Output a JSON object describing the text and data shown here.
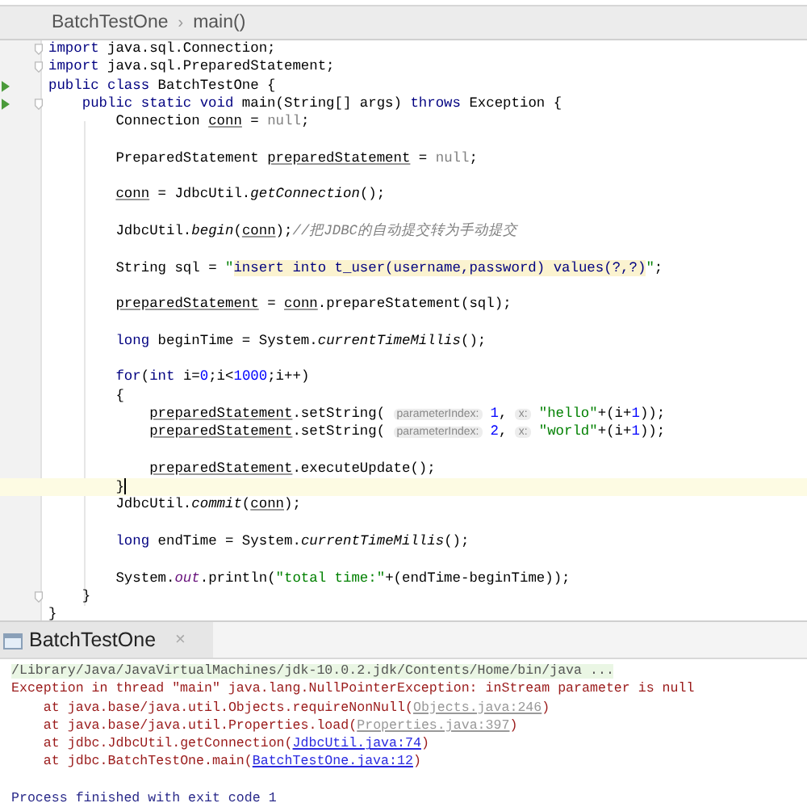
{
  "breadcrumbs": [
    {
      "text": "BatchTestOne"
    },
    {
      "text": "main()"
    }
  ],
  "breadcrumb_separator": "›",
  "editor": {
    "lines": [
      {
        "current": false,
        "run": false,
        "fold": true,
        "tokens": [
          {
            "kind": "kw",
            "text": "import"
          },
          {
            "kind": "plain",
            "text": " java.sql.Connection;"
          }
        ]
      },
      {
        "current": false,
        "run": false,
        "fold": true,
        "tokens": [
          {
            "kind": "kw",
            "text": "import"
          },
          {
            "kind": "plain",
            "text": " java.sql.PreparedStatement;"
          }
        ]
      },
      {
        "current": false,
        "run": true,
        "fold": false,
        "tokens": [
          {
            "kind": "kw",
            "text": "public class"
          },
          {
            "kind": "plain",
            "text": " BatchTestOne {"
          }
        ]
      },
      {
        "current": false,
        "run": true,
        "fold": true,
        "tokens": [
          {
            "kind": "kw",
            "text": "    public static void"
          },
          {
            "kind": "plain",
            "text": " main(String[] args) "
          },
          {
            "kind": "kw",
            "text": "throws"
          },
          {
            "kind": "plain",
            "text": " Exception {"
          }
        ]
      },
      {
        "current": false,
        "run": false,
        "fold": false,
        "tokens": [
          {
            "kind": "plain",
            "text": "        Connection "
          },
          {
            "kind": "var",
            "text": "conn"
          },
          {
            "kind": "plain",
            "text": " = "
          },
          {
            "kind": "null",
            "text": "null"
          },
          {
            "kind": "plain",
            "text": ";"
          }
        ]
      },
      {
        "current": false,
        "run": false,
        "fold": false
      },
      {
        "current": false,
        "run": false,
        "fold": false,
        "tokens": [
          {
            "kind": "plain",
            "text": "        PreparedStatement "
          },
          {
            "kind": "var",
            "text": "preparedStatement"
          },
          {
            "kind": "plain",
            "text": " = "
          },
          {
            "kind": "null",
            "text": "null"
          },
          {
            "kind": "plain",
            "text": ";"
          }
        ]
      },
      {
        "current": false,
        "run": false,
        "fold": false
      },
      {
        "current": false,
        "run": false,
        "fold": false,
        "tokens": [
          {
            "kind": "var",
            "text": "        conn"
          },
          {
            "kind": "plain",
            "text": " = JdbcUtil."
          },
          {
            "kind": "method",
            "text": "getConnection"
          },
          {
            "kind": "plain",
            "text": "();"
          }
        ]
      },
      {
        "current": false,
        "run": false,
        "fold": false
      },
      {
        "current": false,
        "run": false,
        "fold": false,
        "tokens": [
          {
            "kind": "plain",
            "text": "        JdbcUtil."
          },
          {
            "kind": "method",
            "text": "begin"
          },
          {
            "kind": "plain",
            "text": "("
          },
          {
            "kind": "var",
            "text": "conn"
          },
          {
            "kind": "plain",
            "text": ");"
          },
          {
            "kind": "comment",
            "text": "//把JDBC的自动提交转为手动提交"
          }
        ]
      },
      {
        "current": false,
        "run": false,
        "fold": false
      },
      {
        "current": false,
        "run": false,
        "fold": false,
        "tokens": [
          {
            "kind": "plain",
            "text": "        String sql = "
          },
          {
            "kind": "str",
            "text": "\""
          },
          {
            "kind": "inject",
            "text": "insert into t_user(username,password) values(?,?)"
          },
          {
            "kind": "str",
            "text": "\""
          },
          {
            "kind": "plain",
            "text": ";"
          }
        ]
      },
      {
        "current": false,
        "run": false,
        "fold": false
      },
      {
        "current": false,
        "run": false,
        "fold": false,
        "tokens": [
          {
            "kind": "var",
            "text": "        preparedStatement"
          },
          {
            "kind": "plain",
            "text": " = "
          },
          {
            "kind": "var",
            "text": "conn"
          },
          {
            "kind": "plain",
            "text": ".prepareStatement(sql);"
          }
        ]
      },
      {
        "current": false,
        "run": false,
        "fold": false
      },
      {
        "current": false,
        "run": false,
        "fold": false,
        "tokens": [
          {
            "kind": "kw",
            "text": "        long"
          },
          {
            "kind": "plain",
            "text": " beginTime = System."
          },
          {
            "kind": "method",
            "text": "currentTimeMillis"
          },
          {
            "kind": "plain",
            "text": "();"
          }
        ]
      },
      {
        "current": false,
        "run": false,
        "fold": false
      },
      {
        "current": false,
        "run": false,
        "fold": false,
        "tokens": [
          {
            "kind": "kw",
            "text": "        for"
          },
          {
            "kind": "plain",
            "text": "("
          },
          {
            "kind": "kw",
            "text": "int"
          },
          {
            "kind": "plain",
            "text": " i="
          },
          {
            "kind": "num",
            "text": "0"
          },
          {
            "kind": "plain",
            "text": ";i<"
          },
          {
            "kind": "num",
            "text": "1000"
          },
          {
            "kind": "plain",
            "text": ";i++)"
          }
        ]
      },
      {
        "current": false,
        "run": false,
        "fold": false,
        "tokens": [
          {
            "kind": "plain",
            "text": "        {"
          }
        ]
      },
      {
        "current": false,
        "run": false,
        "fold": false,
        "tokens": [
          {
            "kind": "var",
            "text": "            preparedStatement"
          },
          {
            "kind": "plain",
            "text": ".setString( "
          },
          {
            "kind": "hint",
            "text": "parameterIndex:"
          },
          {
            "kind": "num",
            "text": "1"
          },
          {
            "kind": "plain",
            "text": ", "
          },
          {
            "kind": "hint",
            "text": "x:"
          },
          {
            "kind": "str",
            "text": "\"hello\""
          },
          {
            "kind": "plain",
            "text": "+(i+"
          },
          {
            "kind": "num",
            "text": "1"
          },
          {
            "kind": "plain",
            "text": "));"
          }
        ]
      },
      {
        "current": false,
        "run": false,
        "fold": false,
        "tokens": [
          {
            "kind": "var",
            "text": "            preparedStatement"
          },
          {
            "kind": "plain",
            "text": ".setString( "
          },
          {
            "kind": "hint",
            "text": "parameterIndex:"
          },
          {
            "kind": "num",
            "text": "2"
          },
          {
            "kind": "plain",
            "text": ", "
          },
          {
            "kind": "hint",
            "text": "x:"
          },
          {
            "kind": "str",
            "text": "\"world\""
          },
          {
            "kind": "plain",
            "text": "+(i+"
          },
          {
            "kind": "num",
            "text": "1"
          },
          {
            "kind": "plain",
            "text": "));"
          }
        ]
      },
      {
        "current": false,
        "run": false,
        "fold": false
      },
      {
        "current": false,
        "run": false,
        "fold": false,
        "tokens": [
          {
            "kind": "var",
            "text": "            preparedStatement"
          },
          {
            "kind": "plain",
            "text": ".executeUpdate();"
          }
        ]
      },
      {
        "current": true,
        "run": false,
        "fold": false,
        "tokens": [
          {
            "kind": "plain",
            "text": "        }"
          }
        ]
      },
      {
        "current": false,
        "run": false,
        "fold": false,
        "tokens": [
          {
            "kind": "plain",
            "text": "        JdbcUtil."
          },
          {
            "kind": "method",
            "text": "commit"
          },
          {
            "kind": "plain",
            "text": "("
          },
          {
            "kind": "var",
            "text": "conn"
          },
          {
            "kind": "plain",
            "text": ");"
          }
        ]
      },
      {
        "current": false,
        "run": false,
        "fold": false
      },
      {
        "current": false,
        "run": false,
        "fold": false,
        "tokens": [
          {
            "kind": "kw",
            "text": "        long"
          },
          {
            "kind": "plain",
            "text": " endTime = System."
          },
          {
            "kind": "method",
            "text": "currentTimeMillis"
          },
          {
            "kind": "plain",
            "text": "();"
          }
        ]
      },
      {
        "current": false,
        "run": false,
        "fold": false
      },
      {
        "current": false,
        "run": false,
        "fold": false,
        "tokens": [
          {
            "kind": "plain",
            "text": "        System."
          },
          {
            "kind": "field",
            "text": "out"
          },
          {
            "kind": "plain",
            "text": ".println("
          },
          {
            "kind": "str",
            "text": "\"total time:\""
          },
          {
            "kind": "plain",
            "text": "+(endTime-beginTime));"
          }
        ]
      },
      {
        "current": false,
        "run": false,
        "fold": true,
        "tokens": [
          {
            "kind": "plain",
            "text": "    }"
          }
        ]
      },
      {
        "current": false,
        "run": false,
        "fold": false,
        "tokens": [
          {
            "kind": "plain",
            "text": "}"
          }
        ]
      }
    ]
  },
  "run_panel": {
    "tab": {
      "label": "BatchTestOne",
      "close": "×",
      "selected": true
    },
    "console": [
      {
        "tokens": [
          {
            "kind": "cmd",
            "text": "/Library/Java/JavaVirtualMachines/jdk-10.0.2.jdk/Contents/Home/bin/java ..."
          }
        ]
      },
      {
        "tokens": [
          {
            "kind": "err",
            "text": "Exception in thread \"main\" java.lang.NullPointerException: inStream parameter is null"
          }
        ]
      },
      {
        "tokens": [
          {
            "kind": "err",
            "text": "    at java.base/java.util.Objects.requireNonNull("
          },
          {
            "kind": "link_muted",
            "text": "Objects.java:246"
          },
          {
            "kind": "err",
            "text": ")"
          }
        ]
      },
      {
        "tokens": [
          {
            "kind": "err",
            "text": "    at java.base/java.util.Properties.load("
          },
          {
            "kind": "link_muted",
            "text": "Properties.java:397"
          },
          {
            "kind": "err",
            "text": ")"
          }
        ]
      },
      {
        "tokens": [
          {
            "kind": "err",
            "text": "    at jdbc.JdbcUtil.getConnection("
          },
          {
            "kind": "link",
            "text": "JdbcUtil.java:74"
          },
          {
            "kind": "err",
            "text": ")"
          }
        ]
      },
      {
        "tokens": [
          {
            "kind": "err",
            "text": "    at jdbc.BatchTestOne.main("
          },
          {
            "kind": "link",
            "text": "BatchTestOne.java:12"
          },
          {
            "kind": "err",
            "text": ")"
          }
        ]
      },
      {
        "tokens": [
          {
            "kind": "exit",
            "text": "Process finished with exit code 1"
          }
        ]
      }
    ]
  }
}
